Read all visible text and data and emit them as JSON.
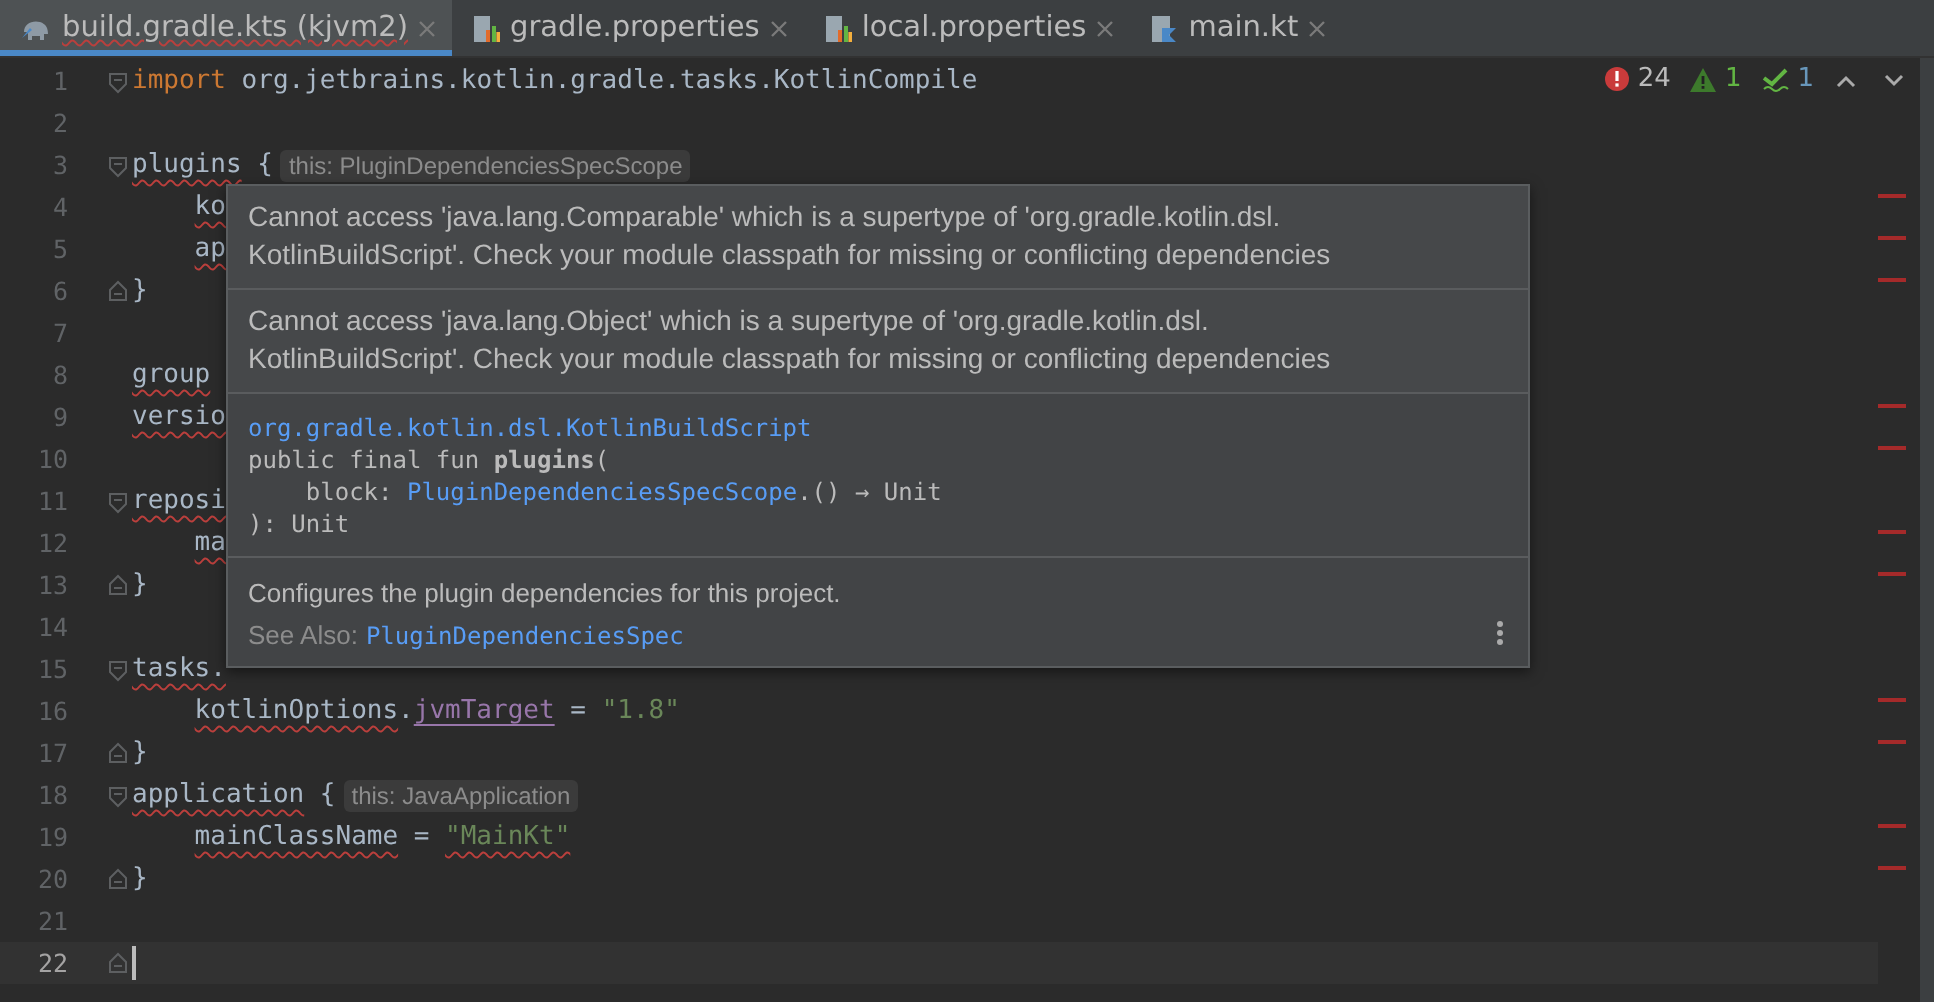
{
  "tabs": [
    {
      "label": "build.gradle.kts (kjvm2)",
      "kind": "gradle",
      "selected": true,
      "error": true
    },
    {
      "label": "gradle.properties",
      "kind": "properties",
      "selected": false,
      "error": false
    },
    {
      "label": "local.properties",
      "kind": "properties",
      "selected": false,
      "error": false
    },
    {
      "label": "main.kt",
      "kind": "kotlin",
      "selected": false,
      "error": false
    }
  ],
  "inspections": {
    "errors": "24",
    "warnings": "1",
    "typos": "1"
  },
  "lines": [
    {
      "number": "1",
      "fold": {
        "kind": "start"
      },
      "current": false,
      "indented": false,
      "tokens": [
        {
          "text": "import",
          "kind": "keyword",
          "error": false
        },
        {
          "text": " org.jetbrains.kotlin.gradle.tasks.KotlinCompile",
          "kind": "plain",
          "error": false
        }
      ]
    },
    {
      "number": "2",
      "current": false
    },
    {
      "number": "3",
      "fold": {
        "kind": "start"
      },
      "current": false,
      "indented": false,
      "tokens": [
        {
          "text": "plugins",
          "kind": "plain",
          "error": true
        },
        {
          "text": " {",
          "kind": "plain",
          "error": false
        }
      ],
      "hint": "this: PluginDependenciesSpecScope"
    },
    {
      "number": "4",
      "current": false,
      "indented": true,
      "tokens": [
        {
          "text": "ko",
          "kind": "plain",
          "error": true
        }
      ]
    },
    {
      "number": "5",
      "current": false,
      "indented": true,
      "tokens": [
        {
          "text": "ap",
          "kind": "plain",
          "error": true
        }
      ]
    },
    {
      "number": "6",
      "fold": {
        "kind": "end"
      },
      "current": false,
      "indented": false,
      "tokens": [
        {
          "text": "}",
          "kind": "plain",
          "error": false
        }
      ]
    },
    {
      "number": "7",
      "current": false
    },
    {
      "number": "8",
      "current": false,
      "indented": false,
      "tokens": [
        {
          "text": "group",
          "kind": "plain",
          "error": true
        }
      ]
    },
    {
      "number": "9",
      "current": false,
      "indented": false,
      "tokens": [
        {
          "text": "versio",
          "kind": "plain",
          "error": true
        }
      ]
    },
    {
      "number": "10",
      "current": false
    },
    {
      "number": "11",
      "fold": {
        "kind": "start"
      },
      "current": false,
      "indented": false,
      "tokens": [
        {
          "text": "reposi",
          "kind": "plain",
          "error": true
        }
      ]
    },
    {
      "number": "12",
      "current": false,
      "indented": true,
      "tokens": [
        {
          "text": "ma",
          "kind": "plain",
          "error": true
        }
      ]
    },
    {
      "number": "13",
      "fold": {
        "kind": "end"
      },
      "current": false,
      "indented": false,
      "tokens": [
        {
          "text": "}",
          "kind": "plain",
          "error": false
        }
      ]
    },
    {
      "number": "14",
      "current": false
    },
    {
      "number": "15",
      "fold": {
        "kind": "start"
      },
      "current": false,
      "indented": false,
      "tokens": [
        {
          "text": "tasks.",
          "kind": "plain",
          "error": true
        }
      ]
    },
    {
      "number": "16",
      "current": false,
      "indented": true,
      "tokens": [
        {
          "text": "kotlinOptions",
          "kind": "plain",
          "error": true
        },
        {
          "text": ".",
          "kind": "plain",
          "error": false
        },
        {
          "text": "jvmTarget",
          "kind": "property",
          "error": false
        },
        {
          "text": " = ",
          "kind": "plain",
          "error": false
        },
        {
          "text": "\"1.8\"",
          "kind": "string",
          "error": false
        }
      ]
    },
    {
      "number": "17",
      "fold": {
        "kind": "end"
      },
      "current": false,
      "indented": false,
      "tokens": [
        {
          "text": "}",
          "kind": "plain",
          "error": false
        }
      ]
    },
    {
      "number": "18",
      "fold": {
        "kind": "start"
      },
      "current": false,
      "indented": false,
      "tokens": [
        {
          "text": "application",
          "kind": "plain",
          "error": true
        },
        {
          "text": " {",
          "kind": "plain",
          "error": false
        }
      ],
      "hint": "this: JavaApplication"
    },
    {
      "number": "19",
      "current": false,
      "indented": true,
      "tokens": [
        {
          "text": "mainClassName",
          "kind": "plain",
          "error": true
        },
        {
          "text": " = ",
          "kind": "plain",
          "error": false
        },
        {
          "text": "\"MainKt\"",
          "kind": "string",
          "error": true
        }
      ]
    },
    {
      "number": "20",
      "fold": {
        "kind": "end"
      },
      "current": false,
      "indented": false,
      "tokens": [
        {
          "text": "}",
          "kind": "plain",
          "error": false
        }
      ]
    },
    {
      "number": "21",
      "current": false
    },
    {
      "number": "22",
      "fold": {
        "kind": "end"
      },
      "current": true
    }
  ],
  "popup": {
    "messages": [
      "Cannot access 'java.lang.Comparable' which is a supertype of 'org.gradle.kotlin.dsl. KotlinBuildScript'. Check your module classpath for missing or conflicting dependencies",
      "Cannot access 'java.lang.Object' which is a supertype of 'org.gradle.kotlin.dsl. KotlinBuildScript'. Check your module classpath for missing or conflicting dependencies"
    ],
    "qualified_name": "org.gradle.kotlin.dsl.KotlinBuildScript",
    "signature": {
      "line_1": "public final fun **plugins**(",
      "line_2_prefix": "    block: ",
      "line_2_link": "PluginDependenciesSpecScope",
      "line_2_suffix": ".() → Unit",
      "line_3": "): Unit"
    },
    "description": "Configures the plugin dependencies for this project.",
    "see_also_label": "See Also:",
    "see_also_link": "PluginDependenciesSpec"
  }
}
